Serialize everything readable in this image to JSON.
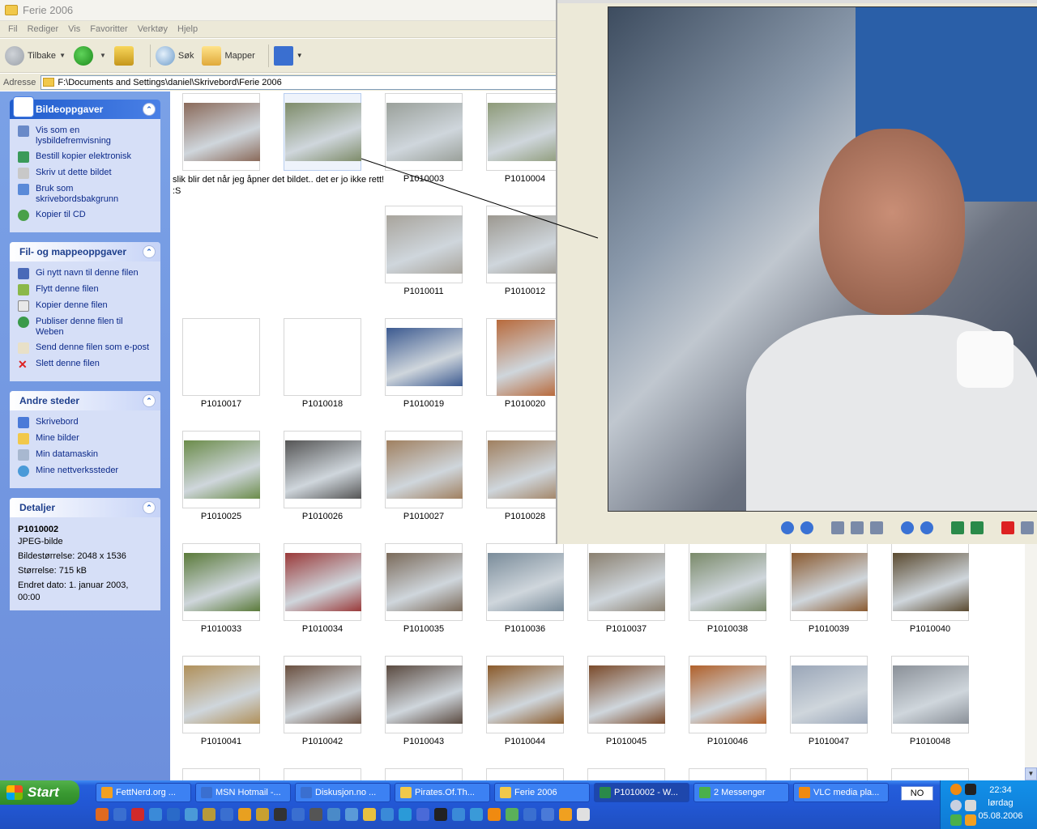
{
  "window": {
    "title": "Ferie 2006",
    "menu": [
      "Fil",
      "Rediger",
      "Vis",
      "Favoritter",
      "Verktøy",
      "Hjelp"
    ],
    "toolbar": {
      "back": "Tilbake",
      "search": "Søk",
      "folders": "Mapper"
    },
    "address_label": "Adresse",
    "address_value": "F:\\Documents and Settings\\daniel\\Skrivebord\\Ferie 2006"
  },
  "taskpane": {
    "picture_tasks": {
      "title": "Bildeoppgaver",
      "items": [
        "Vis som en lysbildefremvisning",
        "Bestill kopier elektronisk",
        "Skriv ut dette bildet",
        "Bruk som skrivebordsbakgrunn",
        "Kopier til CD"
      ]
    },
    "file_tasks": {
      "title": "Fil- og mappeoppgaver",
      "items": [
        "Gi nytt navn til denne filen",
        "Flytt denne filen",
        "Kopier denne filen",
        "Publiser denne filen til Weben",
        "Send denne filen som e-post",
        "Slett denne filen"
      ]
    },
    "other_places": {
      "title": "Andre steder",
      "items": [
        "Skrivebord",
        "Mine bilder",
        "Min datamaskin",
        "Mine nettverkssteder"
      ]
    },
    "details": {
      "title": "Detaljer",
      "name": "P1010002",
      "type": "JPEG-bilde",
      "dimensions": "Bildestørrelse: 2048 x 1536",
      "size": "Størrelse: 715 kB",
      "modified": "Endret dato: 1. januar 2003, 00:00"
    }
  },
  "comment": "slik blir det når jeg åpner det bildet.. det er jo ikke rett! :S",
  "thumbnails": [
    {
      "label": "",
      "color": "#8a6a5a"
    },
    {
      "label": "",
      "color": "#7e8c6a"
    },
    {
      "label": "P1010003",
      "color": "#9aa09a"
    },
    {
      "label": "P1010004",
      "color": "#8d9a78"
    },
    {
      "label": "P1010011",
      "color": "#a8a49c"
    },
    {
      "label": "P1010012",
      "color": "#9c9890"
    },
    {
      "label": "P1010017",
      "color": ""
    },
    {
      "label": "P1010018",
      "color": ""
    },
    {
      "label": "P1010019",
      "color": "#3c5a90"
    },
    {
      "label": "P1010020",
      "color": "#b86a3c"
    },
    {
      "label": "P1010025",
      "color": "#6b8c4a"
    },
    {
      "label": "P1010026",
      "color": "#555555"
    },
    {
      "label": "P1010027",
      "color": "#a08060"
    },
    {
      "label": "P1010028",
      "color": "#a08060"
    },
    {
      "label": "P1010033",
      "color": "#5a7a3a"
    },
    {
      "label": "P1010034",
      "color": "#9a3a3a"
    },
    {
      "label": "P1010035",
      "color": "#7a6a5a"
    },
    {
      "label": "P1010036",
      "color": "#7a8c9a"
    },
    {
      "label": "P1010037",
      "color": "#8a8070"
    },
    {
      "label": "P1010038",
      "color": "#7a8a6a"
    },
    {
      "label": "P1010039",
      "color": "#8a5a30"
    },
    {
      "label": "P1010040",
      "color": "#5a4a30"
    },
    {
      "label": "P1010041",
      "color": "#b0905a"
    },
    {
      "label": "P1010042",
      "color": "#6a5040"
    },
    {
      "label": "P1010043",
      "color": "#5a4a40"
    },
    {
      "label": "P1010044",
      "color": "#8a5a2a"
    },
    {
      "label": "P1010045",
      "color": "#7a4a2a"
    },
    {
      "label": "P1010046",
      "color": "#b0602a"
    },
    {
      "label": "P1010047",
      "color": "#9aa6b8"
    },
    {
      "label": "P1010048",
      "color": "#8a9098"
    }
  ],
  "taskbar": {
    "start": "Start",
    "tasks": [
      {
        "label": "FettNerd.org ...",
        "color": "#f3a020"
      },
      {
        "label": "MSN Hotmail -...",
        "color": "#3a6fd0"
      },
      {
        "label": "Diskusjon.no ...",
        "color": "#3a6fd0"
      },
      {
        "label": "Pirates.Of.Th...",
        "color": "#f1c84b"
      },
      {
        "label": "Ferie 2006",
        "color": "#f1c84b"
      },
      {
        "label": "P1010002 - W...",
        "color": "#2a8a4a"
      },
      {
        "label": "2 Messenger",
        "color": "#4ab04a"
      },
      {
        "label": "VLC media pla...",
        "color": "#f08a10"
      }
    ],
    "language": "NO",
    "time": "22:34",
    "day": "lørdag",
    "date": "05.08.2006"
  }
}
